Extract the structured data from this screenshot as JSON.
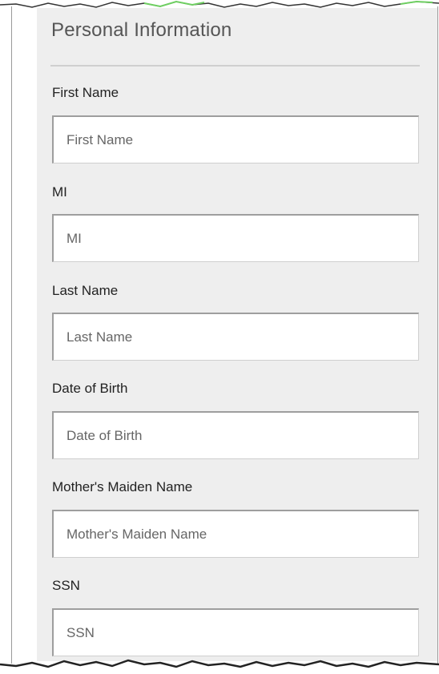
{
  "section": {
    "title": "Personal Information"
  },
  "fields": [
    {
      "label": "First Name",
      "value": "",
      "placeholder": "First Name"
    },
    {
      "label": "MI",
      "value": "",
      "placeholder": "MI"
    },
    {
      "label": "Last Name",
      "value": "",
      "placeholder": "Last Name"
    },
    {
      "label": "Date of Birth",
      "value": "",
      "placeholder": "Date of Birth"
    },
    {
      "label": "Mother's Maiden Name",
      "value": "",
      "placeholder": "Mother's Maiden Name"
    },
    {
      "label": "SSN",
      "value": "",
      "placeholder": "SSN"
    }
  ],
  "colors": {
    "panel_background": "#eeeeee",
    "input_background": "#ffffff",
    "title_text": "#555555",
    "label_text": "#222222",
    "placeholder_text": "#666666"
  }
}
